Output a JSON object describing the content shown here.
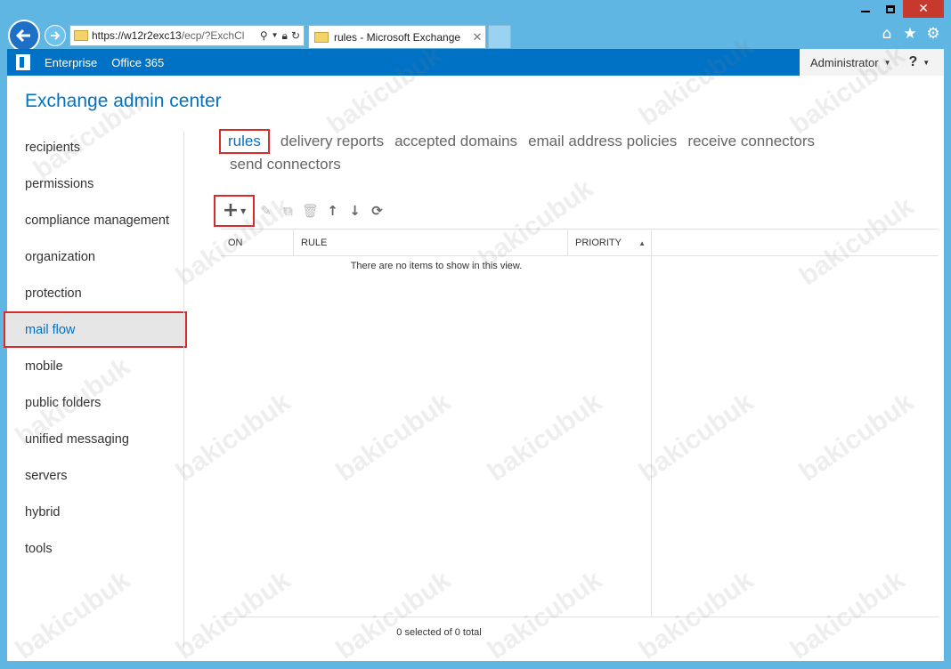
{
  "browser": {
    "url": "https://w12r2exc13/ecp/?ExchCl",
    "url_host": "https://w12r2exc13",
    "url_path": "/ecp/?ExchCl",
    "tab_title": "rules - Microsoft Exchange"
  },
  "topbar": {
    "enterprise_label": "Enterprise",
    "office365_label": "Office 365",
    "user_label": "Administrator",
    "help_label": "?"
  },
  "app_title": "Exchange admin center",
  "nav": {
    "items": [
      {
        "label": "recipients"
      },
      {
        "label": "permissions"
      },
      {
        "label": "compliance management"
      },
      {
        "label": "organization"
      },
      {
        "label": "protection"
      },
      {
        "label": "mail flow"
      },
      {
        "label": "mobile"
      },
      {
        "label": "public folders"
      },
      {
        "label": "unified messaging"
      },
      {
        "label": "servers"
      },
      {
        "label": "hybrid"
      },
      {
        "label": "tools"
      }
    ],
    "active": "mail flow"
  },
  "subtabs": [
    {
      "label": "rules"
    },
    {
      "label": "delivery reports"
    },
    {
      "label": "accepted domains"
    },
    {
      "label": "email address policies"
    },
    {
      "label": "receive connectors"
    },
    {
      "label": "send connectors"
    }
  ],
  "grid": {
    "columns": [
      "ON",
      "RULE",
      "PRIORITY"
    ],
    "empty_message": "There are no items to show in this view.",
    "status": "0 selected of 0 total"
  },
  "watermark": "bakicubuk",
  "colors": {
    "accent": "#0072c6",
    "highlight_border": "#d62c2c",
    "frame": "#5fb6e3"
  }
}
